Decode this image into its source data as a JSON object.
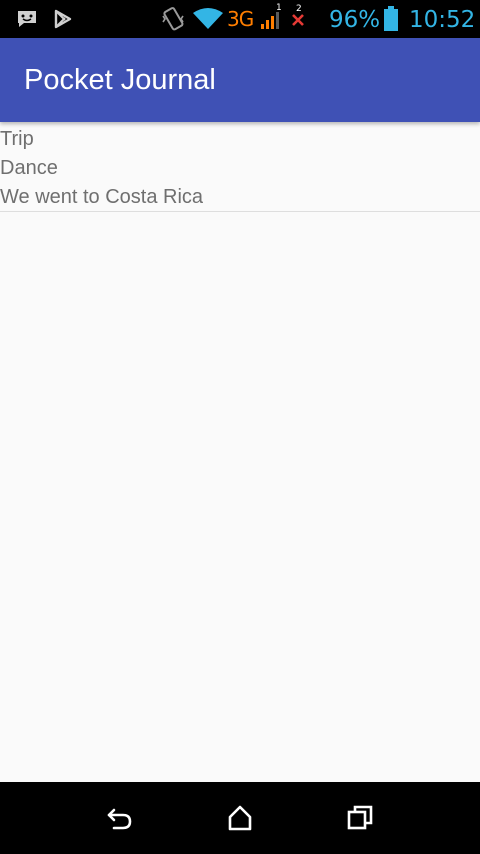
{
  "status_bar": {
    "icons": [
      "message-icon",
      "play-store-icon",
      "vibrate-icon",
      "wifi-icon",
      "signal-icon",
      "no-signal-icon",
      "battery-icon"
    ],
    "network_type": "3G",
    "sim1_label": "1",
    "sim2_label": "2",
    "battery_percent": "96%",
    "time": "10:52",
    "colors": {
      "icon_blue": "#33b5e5",
      "network_orange": "#ff7e00",
      "no_signal_red": "#e53935"
    }
  },
  "app_bar": {
    "title": "Pocket Journal",
    "color": "#3f51b5"
  },
  "entries": [
    {
      "title": "Trip",
      "subtitle": "Dance",
      "body": "We went to Costa Rica"
    }
  ],
  "nav_bar": {
    "buttons": [
      "back-icon",
      "home-icon",
      "recents-icon"
    ]
  }
}
